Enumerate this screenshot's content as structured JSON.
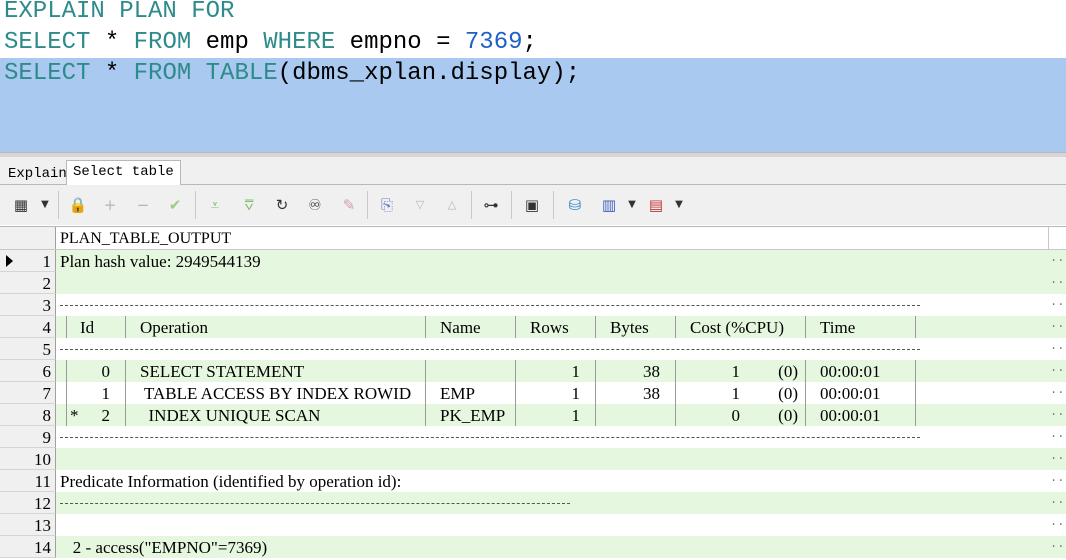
{
  "editor": {
    "line1": {
      "kw1": "EXPLAIN PLAN FOR"
    },
    "line2": {
      "kw1": "SELECT",
      "star": " * ",
      "kw2": "FROM",
      "table": " emp ",
      "kw3": "WHERE",
      "col": " empno = ",
      "num": "7369",
      "end": ";"
    },
    "line3": {
      "kw1": "SELECT",
      "star": " * ",
      "kw2": "FROM",
      "sp": " ",
      "kw3": "TABLE",
      "rest": "(dbms_xplan.display);"
    }
  },
  "tabs": {
    "explain": "Explain",
    "select_table": "Select table"
  },
  "grid": {
    "column_header": "PLAN_TABLE_OUTPUT",
    "rows": [
      {
        "n": "1",
        "text": "Plan hash value: 2949544139"
      },
      {
        "n": "2",
        "text": ""
      },
      {
        "n": "3",
        "text": ""
      },
      {
        "n": "4",
        "text": ""
      },
      {
        "n": "5",
        "text": ""
      },
      {
        "n": "6",
        "text": ""
      },
      {
        "n": "7",
        "text": ""
      },
      {
        "n": "8",
        "text": ""
      },
      {
        "n": "9",
        "text": ""
      },
      {
        "n": "10",
        "text": ""
      },
      {
        "n": "11",
        "text": "Predicate Information (identified by operation id):"
      },
      {
        "n": "12",
        "text": ""
      },
      {
        "n": "13",
        "text": ""
      },
      {
        "n": "14",
        "text": "   2 - access(\"EMPNO\"=7369)"
      }
    ],
    "plan_header": {
      "id": "Id",
      "operation": "Operation",
      "name": "Name",
      "rows": "Rows",
      "bytes": "Bytes",
      "cost": "Cost (%CPU)",
      "time": "Time"
    },
    "plan_rows": [
      {
        "star": "",
        "id": "0",
        "operation": "SELECT STATEMENT",
        "name": "",
        "rows": "1",
        "bytes": "38",
        "cost": "1",
        "cpu": "(0)",
        "time": "00:00:01"
      },
      {
        "star": "",
        "id": "1",
        "operation": " TABLE ACCESS BY INDEX ROWID",
        "name": "EMP",
        "rows": "1",
        "bytes": "38",
        "cost": "1",
        "cpu": "(0)",
        "time": "00:00:01"
      },
      {
        "star": "*",
        "id": "2",
        "operation": "  INDEX UNIQUE SCAN",
        "name": "PK_EMP",
        "rows": "1",
        "bytes": "",
        "cost": "0",
        "cpu": "(0)",
        "time": "00:00:01"
      }
    ],
    "ellipsis": "..."
  },
  "icons": [
    "grid-icon",
    "lock-icon",
    "plus-icon",
    "minus-icon",
    "check-icon",
    "fetch-next-icon",
    "fetch-last-icon",
    "refresh-icon",
    "binoculars-icon",
    "eraser-icon",
    "export-icon",
    "arrow-down-icon",
    "arrow-up-icon",
    "tree-icon",
    "save-icon",
    "database-icon",
    "chart-icon",
    "table-icon"
  ]
}
